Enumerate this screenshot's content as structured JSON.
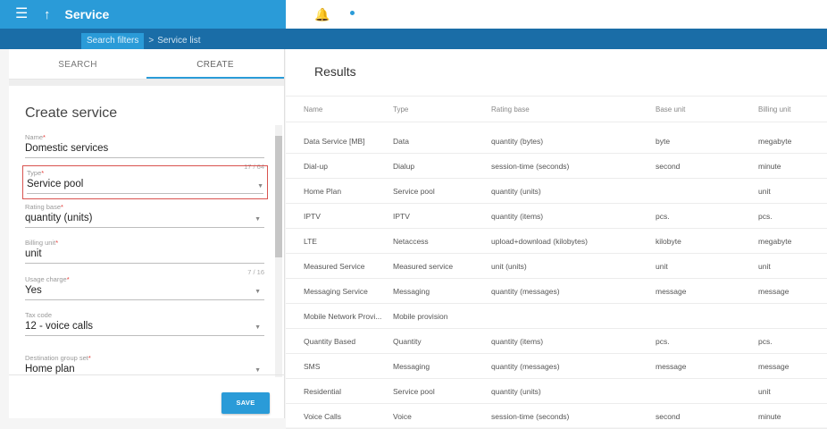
{
  "header": {
    "menu_icon": "hamburger-icon",
    "back_icon": "arrow-up-icon",
    "title": "Service",
    "help_icon": "help-icon",
    "help_glyph": "?",
    "notifications_icon": "bell-icon",
    "account_icon": "user-icon",
    "color": "#2a9bd8"
  },
  "breadcrumb": {
    "current": "Search filters",
    "separator": ">",
    "next": "Service list"
  },
  "tabs": [
    {
      "label": "SEARCH"
    },
    {
      "label": "CREATE"
    }
  ],
  "form": {
    "title": "Create service",
    "name": {
      "label": "Name",
      "required": "*",
      "value": "Domestic services",
      "counter": "17 / 64"
    },
    "type": {
      "label": "Type",
      "required": "*",
      "value": "Service pool"
    },
    "rating_base": {
      "label": "Rating base",
      "required": "*",
      "value": "quantity (units)"
    },
    "billing_unit": {
      "label": "Billing unit",
      "required": "*",
      "value": "unit",
      "counter": "7 / 16"
    },
    "usage_charge": {
      "label": "Usage charge",
      "required": "*",
      "value": "Yes"
    },
    "tax_code": {
      "label": "Tax code",
      "value": "12 - voice calls"
    },
    "destination_group_set": {
      "label": "Destination group set",
      "required": "*",
      "value": "Home plan"
    },
    "dropdown_icon": "dropdown-arrow-icon",
    "save_label": "SAVE"
  },
  "results": {
    "title": "Results",
    "columns": [
      "Name",
      "Type",
      "Rating base",
      "Base unit",
      "Billing unit"
    ],
    "rows": [
      [
        "Data Service [MB]",
        "Data",
        "quantity (bytes)",
        "byte",
        "megabyte"
      ],
      [
        "Dial-up",
        "Dialup",
        "session-time (seconds)",
        "second",
        "minute"
      ],
      [
        "Home Plan",
        "Service pool",
        "quantity (units)",
        "",
        "unit"
      ],
      [
        "IPTV",
        "IPTV",
        "quantity (items)",
        "pcs.",
        "pcs."
      ],
      [
        "LTE",
        "Netaccess",
        "upload+download (kilobytes)",
        "kilobyte",
        "megabyte"
      ],
      [
        "Measured Service",
        "Measured service",
        "unit (units)",
        "unit",
        "unit"
      ],
      [
        "Messaging Service",
        "Messaging",
        "quantity (messages)",
        "message",
        "message"
      ],
      [
        "Mobile Network Provi...",
        "Mobile provision",
        "",
        "",
        ""
      ],
      [
        "Quantity Based",
        "Quantity",
        "quantity (items)",
        "pcs.",
        "pcs."
      ],
      [
        "SMS",
        "Messaging",
        "quantity (messages)",
        "message",
        "message"
      ],
      [
        "Residential",
        "Service pool",
        "quantity (units)",
        "",
        "unit"
      ],
      [
        "Voice Calls",
        "Voice",
        "session-time (seconds)",
        "second",
        "minute"
      ]
    ]
  }
}
